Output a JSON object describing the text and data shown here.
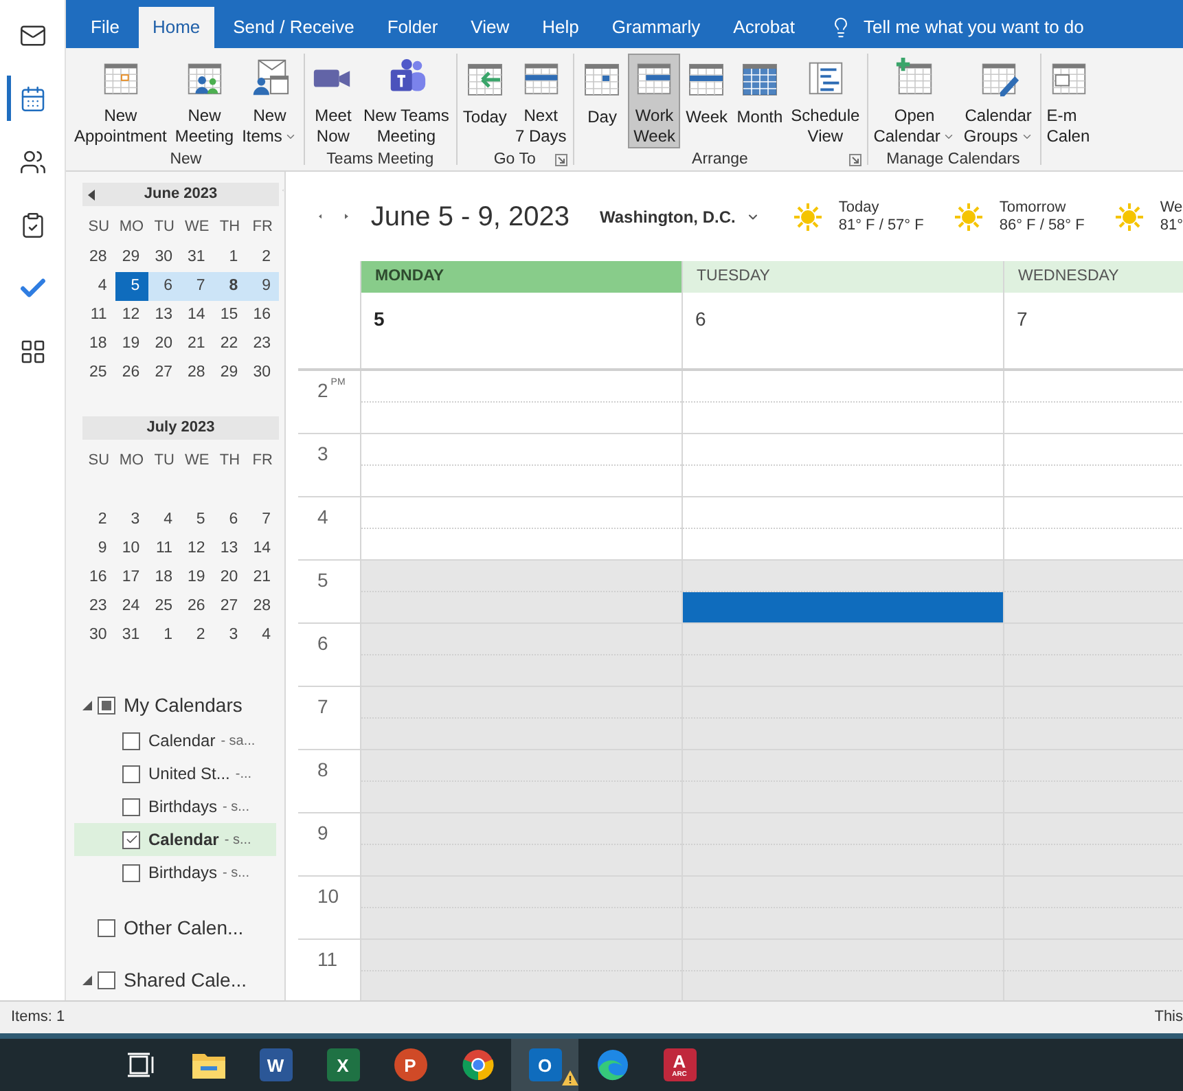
{
  "nav": [
    {
      "kind": "mail",
      "selected": false
    },
    {
      "kind": "calendar",
      "selected": true
    },
    {
      "kind": "people",
      "selected": false
    },
    {
      "kind": "tasks",
      "selected": false
    },
    {
      "kind": "todo",
      "selected": false
    },
    {
      "kind": "apps",
      "selected": false
    }
  ],
  "menu_tabs": [
    {
      "label": "File",
      "selected": false
    },
    {
      "label": "Home",
      "selected": true
    },
    {
      "label": "Send / Receive",
      "selected": false
    },
    {
      "label": "Folder",
      "selected": false
    },
    {
      "label": "View",
      "selected": false
    },
    {
      "label": "Help",
      "selected": false
    },
    {
      "label": "Grammarly",
      "selected": false
    },
    {
      "label": "Acrobat",
      "selected": false
    }
  ],
  "tell_me": {
    "placeholder": "Tell me what you want to do"
  },
  "ribbon": [
    {
      "label": "New",
      "launcher": false,
      "buttons": [
        {
          "kind": "appointment",
          "lines": [
            "New",
            "Appointment"
          ],
          "dropdown": false,
          "selected": false
        },
        {
          "kind": "meeting",
          "lines": [
            "New",
            "Meeting"
          ],
          "dropdown": false,
          "selected": false
        },
        {
          "kind": "items",
          "lines": [
            "New",
            "Items"
          ],
          "dropdown": true,
          "selected": false
        }
      ]
    },
    {
      "label": "Teams Meeting",
      "launcher": false,
      "buttons": [
        {
          "kind": "video",
          "lines": [
            "Meet",
            "Now"
          ],
          "dropdown": false,
          "selected": false
        },
        {
          "kind": "teams",
          "lines": [
            "New Teams",
            "Meeting"
          ],
          "dropdown": false,
          "selected": false
        }
      ]
    },
    {
      "label": "Go To",
      "launcher": true,
      "buttons": [
        {
          "kind": "today",
          "lines": [
            "Today"
          ],
          "dropdown": false,
          "selected": false
        },
        {
          "kind": "next7",
          "lines": [
            "Next",
            "7 Days"
          ],
          "dropdown": false,
          "selected": false
        }
      ]
    },
    {
      "label": "Arrange",
      "launcher": true,
      "buttons": [
        {
          "kind": "day",
          "lines": [
            "Day"
          ],
          "dropdown": false,
          "selected": false
        },
        {
          "kind": "workweek",
          "lines": [
            "Work",
            "Week"
          ],
          "dropdown": false,
          "selected": true
        },
        {
          "kind": "week",
          "lines": [
            "Week"
          ],
          "dropdown": false,
          "selected": false
        },
        {
          "kind": "month",
          "lines": [
            "Month"
          ],
          "dropdown": false,
          "selected": false
        },
        {
          "kind": "schedule",
          "lines": [
            "Schedule",
            "View"
          ],
          "dropdown": false,
          "selected": false
        }
      ]
    },
    {
      "label": "Manage Calendars",
      "launcher": false,
      "buttons": [
        {
          "kind": "open",
          "lines": [
            "Open",
            "Calendar"
          ],
          "dropdown": true,
          "selected": false
        },
        {
          "kind": "groups",
          "lines": [
            "Calendar",
            "Groups"
          ],
          "dropdown": true,
          "selected": false
        }
      ]
    },
    {
      "buttons": [
        {
          "kind": "email",
          "lines": [
            "E-m",
            "Calen"
          ],
          "dropdown": false,
          "selected": false
        }
      ]
    }
  ],
  "mini_calendars": [
    {
      "title": "June 2023",
      "weekdays": [
        "SU",
        "MO",
        "TU",
        "WE",
        "TH",
        "FR"
      ],
      "weeks": [
        [
          "28",
          "29",
          "30",
          "31",
          "1",
          "2"
        ],
        [
          {
            "day": "4",
            "in_week": false,
            "selected": false,
            "bold": false
          },
          {
            "day": "5",
            "in_week": true,
            "selected": true,
            "bold": false
          },
          {
            "day": "6",
            "in_week": true,
            "selected": false,
            "bold": false
          },
          {
            "day": "7",
            "in_week": true,
            "selected": false,
            "bold": false
          },
          {
            "day": "8",
            "in_week": true,
            "selected": false,
            "bold": true
          },
          {
            "day": "9",
            "in_week": true,
            "selected": false,
            "bold": false
          }
        ],
        [
          "11",
          "12",
          "13",
          "14",
          "15",
          "16"
        ],
        [
          "18",
          "19",
          "20",
          "21",
          "22",
          "23"
        ],
        [
          "25",
          "26",
          "27",
          "28",
          "29",
          "30"
        ]
      ]
    },
    {
      "title": "July 2023",
      "weekdays": [
        "SU",
        "MO",
        "TU",
        "WE",
        "TH",
        "FR"
      ],
      "weeks": [
        [
          "2",
          "3",
          "4",
          "5",
          "6",
          "7"
        ],
        [
          "9",
          "10",
          "11",
          "12",
          "13",
          "14"
        ],
        [
          "16",
          "17",
          "18",
          "19",
          "20",
          "21"
        ],
        [
          "23",
          "24",
          "25",
          "26",
          "27",
          "28"
        ],
        [
          "30",
          "31",
          "1",
          "2",
          "3",
          "4"
        ]
      ]
    }
  ],
  "calendar_groups": [
    {
      "name": "My Calendars",
      "expanded": true,
      "checked": false,
      "mixed": true,
      "children": [
        {
          "name": "Calendar",
          "suffix": "- sa...",
          "checked": false,
          "selected": false
        },
        {
          "name": "United St...",
          "suffix": "-...",
          "checked": false,
          "selected": false
        },
        {
          "name": "Birthdays",
          "suffix": "- s...",
          "checked": false,
          "selected": false
        },
        {
          "name": "Calendar",
          "suffix": "- s...",
          "checked": true,
          "selected": true
        },
        {
          "name": "Birthdays",
          "suffix": "- s...",
          "checked": false,
          "selected": false
        }
      ]
    },
    {
      "name": "Other Calen...",
      "checked": false,
      "mixed": false
    },
    {
      "name": "Shared Cale...",
      "expanded": true,
      "checked": false,
      "mixed": false
    }
  ],
  "header": {
    "date_range": "June 5 - 9, 2023",
    "location": "Washington, D.C.",
    "forecast": [
      {
        "day": "Today",
        "temps": "81° F / 57° F"
      },
      {
        "day": "Tomorrow",
        "temps": "86° F / 58° F"
      },
      {
        "day": "We",
        "temps": "81°"
      }
    ]
  },
  "days": [
    {
      "name": "MONDAY",
      "date": "5",
      "selected": true
    },
    {
      "name": "TUESDAY",
      "date": "6",
      "selected": false
    },
    {
      "name": "WEDNESDAY",
      "date": "7",
      "selected": false
    }
  ],
  "hours": [
    {
      "label": "2",
      "suffix": "PM",
      "work": true,
      "cells": [
        {
          "kind": "free"
        },
        {
          "kind": "free"
        },
        {
          "kind": "free"
        }
      ]
    },
    {
      "label": "3",
      "work": true,
      "cells": [
        {
          "kind": "free"
        },
        {
          "kind": "free"
        },
        {
          "kind": "free"
        }
      ]
    },
    {
      "label": "4",
      "work": true,
      "cells": [
        {
          "kind": "free"
        },
        {
          "kind": "free"
        },
        {
          "kind": "free"
        }
      ]
    },
    {
      "label": "5",
      "work": false,
      "cells": [
        {
          "kind": "free"
        },
        {
          "kind": "busy-second-half"
        },
        {
          "kind": "free"
        }
      ]
    },
    {
      "label": "6",
      "work": false,
      "cells": [
        {
          "kind": "free"
        },
        {
          "kind": "free"
        },
        {
          "kind": "free"
        }
      ]
    },
    {
      "label": "7",
      "work": false,
      "cells": [
        {
          "kind": "free"
        },
        {
          "kind": "free"
        },
        {
          "kind": "free"
        }
      ]
    },
    {
      "label": "8",
      "work": false,
      "cells": [
        {
          "kind": "free"
        },
        {
          "kind": "free"
        },
        {
          "kind": "free"
        }
      ]
    },
    {
      "label": "9",
      "work": false,
      "cells": [
        {
          "kind": "free"
        },
        {
          "kind": "free"
        },
        {
          "kind": "free"
        }
      ]
    },
    {
      "label": "10",
      "work": false,
      "cells": [
        {
          "kind": "free"
        },
        {
          "kind": "free"
        },
        {
          "kind": "free"
        }
      ]
    },
    {
      "label": "11",
      "work": false,
      "cells": [
        {
          "kind": "free"
        },
        {
          "kind": "free"
        },
        {
          "kind": "free"
        }
      ]
    }
  ],
  "status_bar": {
    "left": "Items: 1",
    "right": "This"
  },
  "taskbar": [
    {
      "kind": "task-view",
      "selected": false
    },
    {
      "kind": "folder",
      "selected": false
    },
    {
      "kind": "word",
      "glyph": "W",
      "selected": false
    },
    {
      "kind": "excel",
      "glyph": "X",
      "selected": false
    },
    {
      "kind": "powerpoint",
      "glyph": "P",
      "selected": false
    },
    {
      "kind": "chrome",
      "selected": false
    },
    {
      "kind": "outlook",
      "glyph": "O",
      "selected": true
    },
    {
      "kind": "edge",
      "selected": false
    },
    {
      "kind": "access",
      "glyph": "A",
      "sub": "ARC",
      "selected": false
    }
  ]
}
